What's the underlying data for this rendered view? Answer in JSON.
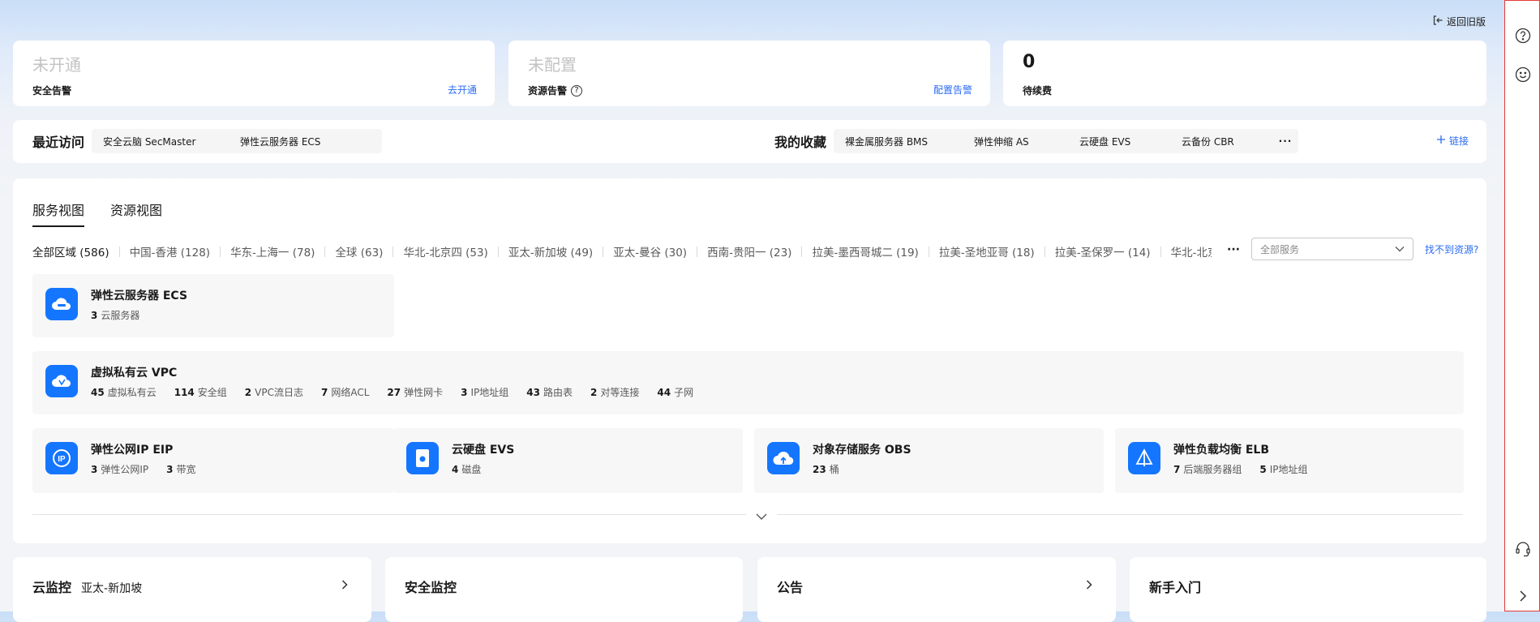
{
  "header": {
    "back_label": "返回旧版"
  },
  "stat_cards": [
    {
      "value": "未开通",
      "label": "安全告警",
      "link": "去开通"
    },
    {
      "value": "未配置",
      "label": "资源告警",
      "link": "配置告警",
      "has_help": true
    },
    {
      "value": "0",
      "label": "待续费"
    }
  ],
  "recent": {
    "title": "最近访问",
    "items": [
      "安全云脑 SecMaster",
      "弹性云服务器 ECS"
    ]
  },
  "favorites": {
    "title": "我的收藏",
    "items": [
      "裸金属服务器 BMS",
      "弹性伸缩 AS",
      "云硬盘 EVS",
      "云备份 CBR"
    ],
    "more": "···",
    "add_label": "链接"
  },
  "main": {
    "tabs": [
      "服务视图",
      "资源视图"
    ],
    "active_tab": 0,
    "regions": [
      "全部区域 (586)",
      "中国-香港 (128)",
      "华东-上海一 (78)",
      "全球 (63)",
      "华北-北京四 (53)",
      "亚太-新加坡 (49)",
      "亚太-曼谷 (30)",
      "西南-贵阳一 (23)",
      "拉美-墨西哥城二 (19)",
      "拉美-圣地亚哥 (18)",
      "拉美-圣保罗一 (14)",
      "华北-北京"
    ],
    "regions_more": "···",
    "service_select_placeholder": "全部服务",
    "cant_find_label": "找不到资源?",
    "services": {
      "ecs": {
        "title": "弹性云服务器 ECS",
        "stats": [
          {
            "n": "3",
            "l": "云服务器"
          }
        ]
      },
      "vpc": {
        "title": "虚拟私有云 VPC",
        "stats": [
          {
            "n": "45",
            "l": "虚拟私有云"
          },
          {
            "n": "114",
            "l": "安全组"
          },
          {
            "n": "2",
            "l": "VPC流日志"
          },
          {
            "n": "7",
            "l": "网络ACL"
          },
          {
            "n": "27",
            "l": "弹性网卡"
          },
          {
            "n": "3",
            "l": "IP地址组"
          },
          {
            "n": "43",
            "l": "路由表"
          },
          {
            "n": "2",
            "l": "对等连接"
          },
          {
            "n": "44",
            "l": "子网"
          }
        ]
      },
      "eip": {
        "title": "弹性公网IP EIP",
        "stats": [
          {
            "n": "3",
            "l": "弹性公网IP"
          },
          {
            "n": "3",
            "l": "带宽"
          }
        ]
      },
      "evs": {
        "title": "云硬盘 EVS",
        "stats": [
          {
            "n": "4",
            "l": "磁盘"
          }
        ]
      },
      "obs": {
        "title": "对象存储服务 OBS",
        "stats": [
          {
            "n": "23",
            "l": "桶"
          }
        ]
      },
      "elb": {
        "title": "弹性负载均衡 ELB",
        "stats": [
          {
            "n": "7",
            "l": "后端服务器组"
          },
          {
            "n": "5",
            "l": "IP地址组"
          }
        ]
      }
    }
  },
  "bottom_cards": [
    {
      "title": "云监控",
      "subtitle": "亚太-新加坡",
      "has_arrow": true
    },
    {
      "title": "安全监控",
      "subtitle": "",
      "has_arrow": false
    },
    {
      "title": "公告",
      "subtitle": "",
      "has_arrow": true
    },
    {
      "title": "新手入门",
      "subtitle": "",
      "has_arrow": false
    }
  ],
  "sidebar_icons": [
    "help-icon",
    "feedback-smile-icon",
    "headset-icon",
    "chevron-right-icon"
  ],
  "colors": {
    "accent": "#2a6bf3",
    "service_icon": "#1476ff",
    "sidebar_border": "#e53935"
  }
}
